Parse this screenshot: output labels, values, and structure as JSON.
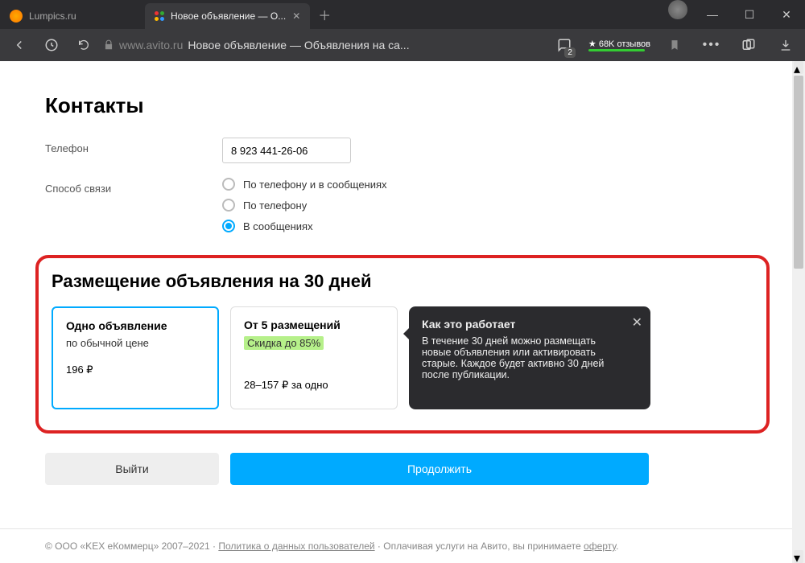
{
  "browser": {
    "tabs": [
      {
        "label": "Lumpics.ru"
      },
      {
        "label": "Новое объявление — О..."
      }
    ],
    "url": {
      "domain": "www.avito.ru",
      "title": "Новое объявление — Объявления на са..."
    },
    "msg_count": "2",
    "extension": {
      "line1": "★ 68K отзывов"
    }
  },
  "page": {
    "h1": "Контакты",
    "phone_label": "Телефон",
    "phone_value": "8 923 441-26-06",
    "contact_method_label": "Способ связи",
    "radio": {
      "opt1": "По телефону и в сообщениях",
      "opt2": "По телефону",
      "opt3": "В сообщениях"
    },
    "placement_h2": "Размещение объявления на 30 дней",
    "card1": {
      "title": "Одно объявление",
      "sub": "по обычной цене",
      "price": "196 ₽"
    },
    "card2": {
      "title": "От 5 размещений",
      "sub": "Скидка до 85%",
      "price": "28–157 ₽ за одно"
    },
    "tooltip": {
      "title": "Как это работает",
      "body": "В течение 30 дней можно размещать новые объявления или активировать старые. Каждое будет активно 30 дней после публикации."
    },
    "buttons": {
      "exit": "Выйти",
      "continue": "Продолжить"
    },
    "footer": {
      "company": "© ООО «KEX еКоммерц» 2007–2021",
      "policy": "Политика о данных пользователей",
      "mid": "Оплачивая услуги на Авито, вы принимаете",
      "offer": "оферту"
    }
  }
}
